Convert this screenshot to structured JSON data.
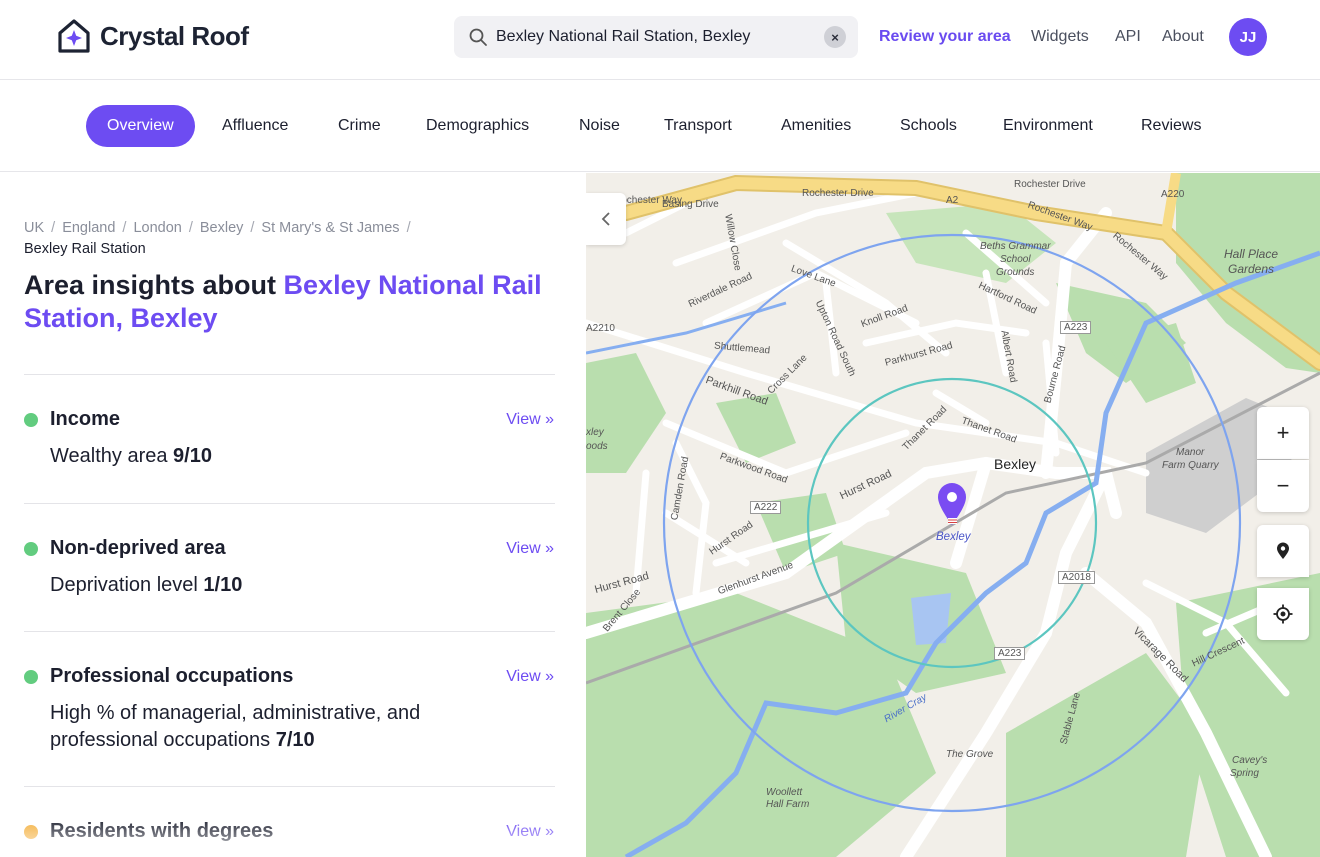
{
  "header": {
    "logo_text": "Crystal Roof",
    "search": {
      "value": "Bexley National Rail Station, Bexley",
      "clear": "×"
    },
    "nav": [
      {
        "label": "Review your area"
      },
      {
        "label": "Widgets"
      },
      {
        "label": "API"
      },
      {
        "label": "About"
      }
    ],
    "avatar": "JJ",
    "accent_color": "#6d4cf2"
  },
  "tabs": [
    {
      "label": "Overview",
      "active": true
    },
    {
      "label": "Affluence"
    },
    {
      "label": "Crime"
    },
    {
      "label": "Demographics"
    },
    {
      "label": "Noise"
    },
    {
      "label": "Transport"
    },
    {
      "label": "Amenities"
    },
    {
      "label": "Schools"
    },
    {
      "label": "Environment"
    },
    {
      "label": "Reviews"
    }
  ],
  "breadcrumb": {
    "items": [
      "UK",
      "England",
      "London",
      "Bexley",
      "St Mary's & St James"
    ],
    "current": "Bexley Rail Station",
    "separator": "/"
  },
  "title": {
    "prefix": "Area insights about ",
    "place": "Bexley National Rail Station, Bexley"
  },
  "stats": [
    {
      "title": "Income",
      "desc": "Wealthy area ",
      "score": "9/10",
      "view": "View »",
      "status_color": "#62cc7f"
    },
    {
      "title": "Non-deprived area",
      "desc": "Deprivation level ",
      "score": "1/10",
      "view": "View »",
      "status_color": "#62cc7f"
    },
    {
      "title": "Professional occupations",
      "desc": "High % of managerial, administrative, and professional occupations ",
      "score": "7/10",
      "view": "View »",
      "status_color": "#62cc7f"
    },
    {
      "title": "Residents with degrees",
      "desc": "",
      "score": "",
      "view": "View »",
      "status_color": "#f4b03e"
    }
  ],
  "map": {
    "pin_label": "Bexley",
    "town_label": "Bexley",
    "controls": {
      "zoom_in": "+",
      "zoom_out": "−"
    },
    "labels": [
      {
        "text": "Rochester Way"
      },
      {
        "text": "Basing Drive"
      },
      {
        "text": "Rochester Drive"
      },
      {
        "text": "A2"
      },
      {
        "text": "Rochester Drive"
      },
      {
        "text": "A220"
      },
      {
        "text": "Rochester Way"
      },
      {
        "text": "Rochester Way"
      },
      {
        "text": "Beths Grammar"
      },
      {
        "text": "School"
      },
      {
        "text": "Grounds"
      },
      {
        "text": "Hall Place"
      },
      {
        "text": "Gardens"
      },
      {
        "text": "Willow Close"
      },
      {
        "text": "Love Lane"
      },
      {
        "text": "Riverdale Road"
      },
      {
        "text": "Knoll Road"
      },
      {
        "text": "Hartford Road"
      },
      {
        "text": "A223"
      },
      {
        "text": "A2210"
      },
      {
        "text": "Shuttlemead"
      },
      {
        "text": "Upton Road South"
      },
      {
        "text": "Parkhurst Road"
      },
      {
        "text": "Albert Road"
      },
      {
        "text": "Bourne Road"
      },
      {
        "text": "Cross Lane"
      },
      {
        "text": "Parkhill Road"
      },
      {
        "text": "Thanet Road"
      },
      {
        "text": "Thanet Road"
      },
      {
        "text": "Manor"
      },
      {
        "text": "Farm Quarry"
      },
      {
        "text": "Parkwood Road"
      },
      {
        "text": "Camden Road"
      },
      {
        "text": "Hurst Road"
      },
      {
        "text": "A222"
      },
      {
        "text": "Hurst Road"
      },
      {
        "text": "Glenhurst Avenue"
      },
      {
        "text": "A2018"
      },
      {
        "text": "Hurst Road"
      },
      {
        "text": "Brent Close"
      },
      {
        "text": "A223"
      },
      {
        "text": "Vicarage Road"
      },
      {
        "text": "Hill Crescent"
      },
      {
        "text": "River Cray"
      },
      {
        "text": "Stable Lane"
      },
      {
        "text": "The Grove"
      },
      {
        "text": "Cavey's"
      },
      {
        "text": "Spring"
      },
      {
        "text": "Woollett"
      },
      {
        "text": "Hall Farm"
      },
      {
        "text": "xley"
      },
      {
        "text": "oods"
      }
    ]
  }
}
